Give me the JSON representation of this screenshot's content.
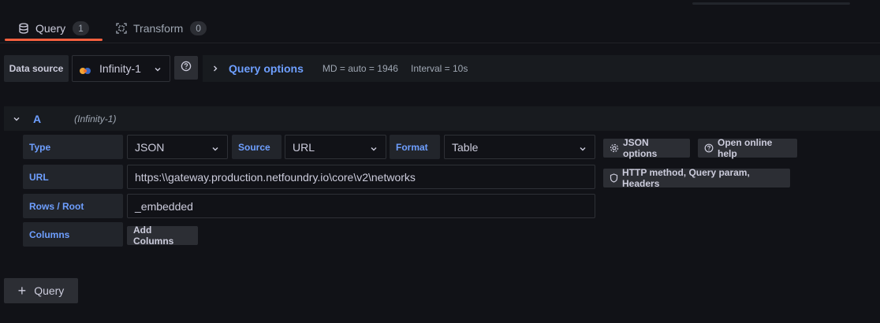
{
  "tabs": [
    {
      "label": "Query",
      "count": "1",
      "icon": "database-icon"
    },
    {
      "label": "Transform",
      "count": "0",
      "icon": "transform-icon"
    }
  ],
  "datasource": {
    "label": "Data source",
    "selected": "Infinity-1"
  },
  "query_options": {
    "title": "Query options",
    "md": "MD = auto = 1946",
    "interval": "Interval = 10s"
  },
  "query": {
    "name": "A",
    "datasource": "(Infinity-1)",
    "type_label": "Type",
    "type_value": "JSON",
    "source_label": "Source",
    "source_value": "URL",
    "format_label": "Format",
    "format_value": "Table",
    "json_options_label": "JSON options",
    "online_help_label": "Open online help",
    "url_label": "URL",
    "url_value": "https:\\\\gateway.production.netfoundry.io\\core\\v2\\networks",
    "http_label": "HTTP method, Query param, Headers",
    "rows_label": "Rows / Root",
    "rows_value": "_embedded",
    "columns_label": "Columns",
    "add_columns_label": "Add Columns"
  },
  "add_query_label": "Query",
  "colors": {
    "accent_blue": "#6e9fff",
    "tab_underline": "#f55f3e",
    "background": "#111217"
  }
}
